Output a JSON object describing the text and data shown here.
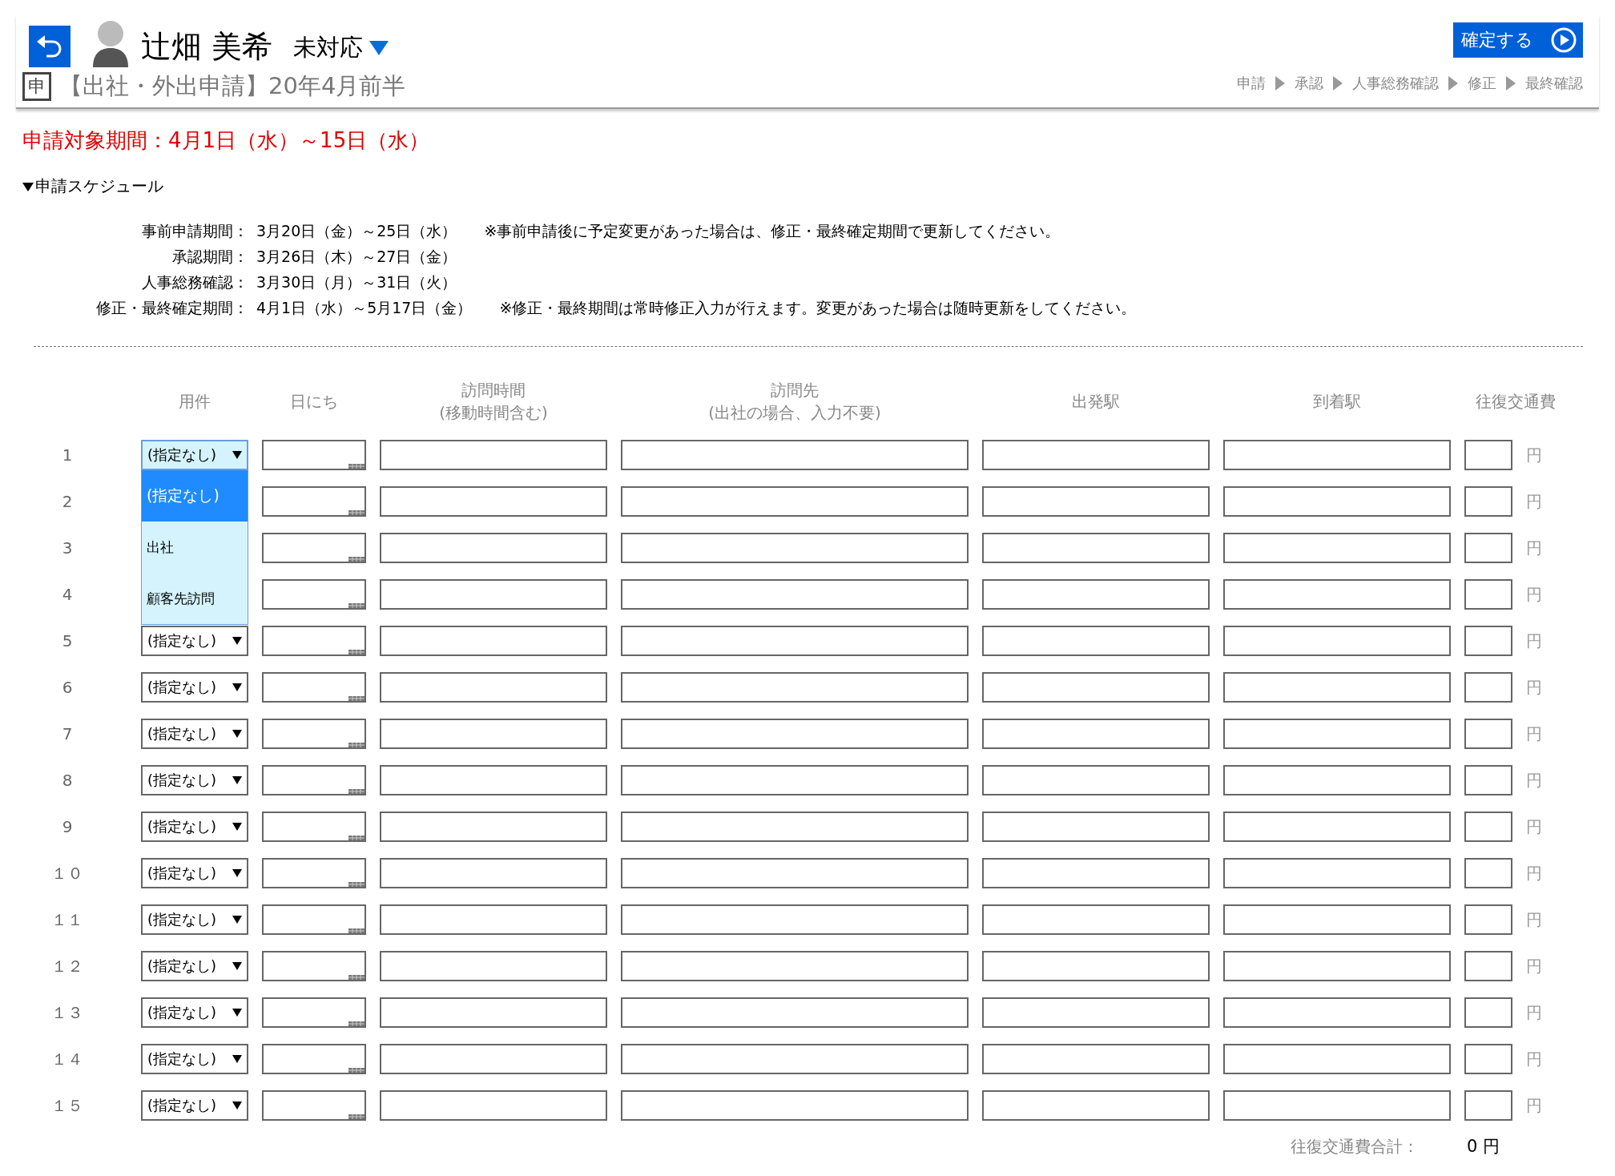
{
  "header": {
    "name": "辻畑 美希",
    "status": "未対応",
    "form_badge": "申",
    "form_title": "【出社・外出申請】20年4月前半",
    "confirm_button": "確定する",
    "steps": [
      "申請",
      "承認",
      "人事総務確認",
      "修正",
      "最終確認"
    ]
  },
  "period": "申請対象期間：4月1日（水）～15日（水）",
  "schedule": {
    "title": "申請スケジュール",
    "expanded": true,
    "rows": [
      {
        "label": "事前申請期間：",
        "value": "3月20日（金）～25日（水）",
        "note": "※事前申請後に予定変更があった場合は、修正・最終確定期間で更新してください。"
      },
      {
        "label": "承認期間：",
        "value": "3月26日（木）～27日（金）"
      },
      {
        "label": "人事総務確認：",
        "value": "3月30日（月）～31日（火）"
      },
      {
        "label": "修正・最終確定期間：",
        "value": "4月1日（水）～5月17日（金）",
        "note": "※修正・最終期間は常時修正入力が行えます。変更があった場合は随時更新をしてください。"
      }
    ]
  },
  "table": {
    "columns": [
      "用件",
      "日にち",
      "訪問時間\n(移動時間含む)",
      "訪問先\n(出社の場合、入力不要)",
      "出発駅",
      "到着駅",
      "往復交通費"
    ],
    "rows": [
      {
        "no": "1",
        "purpose": "(指定なし)",
        "unit": "円",
        "dropdown": {
          "open": true,
          "options": [
            {
              "label": "(指定なし)",
              "selected": true
            },
            {
              "label": "出社",
              "selected": false
            },
            {
              "label": "顧客先訪問",
              "selected": false
            }
          ]
        }
      },
      {
        "no": "2",
        "unit": "円"
      },
      {
        "no": "3",
        "unit": "円"
      },
      {
        "no": "4",
        "unit": "円"
      },
      {
        "no": "5",
        "purpose": "(指定なし)",
        "unit": "円"
      },
      {
        "no": "6",
        "purpose": "(指定なし)",
        "unit": "円"
      },
      {
        "no": "7",
        "purpose": "(指定なし)",
        "unit": "円"
      },
      {
        "no": "8",
        "purpose": "(指定なし)",
        "unit": "円"
      },
      {
        "no": "9",
        "purpose": "(指定なし)",
        "unit": "円"
      },
      {
        "no": "１０",
        "purpose": "(指定なし)",
        "unit": "円"
      },
      {
        "no": "１１",
        "purpose": "(指定なし)",
        "unit": "円"
      },
      {
        "no": "１２",
        "purpose": "(指定なし)",
        "unit": "円"
      },
      {
        "no": "１３",
        "purpose": "(指定なし)",
        "unit": "円"
      },
      {
        "no": "１４",
        "purpose": "(指定なし)",
        "unit": "円"
      },
      {
        "no": "１５",
        "purpose": "(指定なし)",
        "unit": "円"
      }
    ],
    "total_label": "往復交通費合計：",
    "total_value": "0",
    "total_unit": "円"
  }
}
